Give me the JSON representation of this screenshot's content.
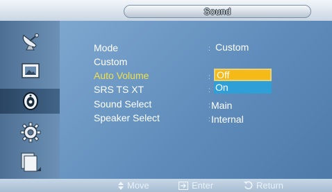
{
  "title": "Sound",
  "sidebar": {
    "items": [
      {
        "icon": "satellite-antenna-icon",
        "active": false
      },
      {
        "icon": "picture-frame-icon",
        "active": false
      },
      {
        "icon": "speaker-icon",
        "active": true
      },
      {
        "icon": "gear-icon",
        "active": false
      },
      {
        "icon": "multi-screen-icon",
        "active": false
      }
    ]
  },
  "menu": {
    "mode_label": "Mode",
    "mode_value": "Custom",
    "custom_label": "Custom",
    "auto_volume_label": "Auto Volume",
    "srs_label": "SRS TS XT",
    "sound_select_label": "Sound Select",
    "sound_select_value": "Main",
    "speaker_select_label": "Speaker Select",
    "speaker_select_value": "Internal",
    "separator": ":"
  },
  "dropdown": {
    "options": [
      "Off",
      "On"
    ],
    "selected": "Off"
  },
  "footer": {
    "move_label": "Move",
    "enter_label": "Enter",
    "return_label": "Return"
  },
  "colors": {
    "highlight_text": "#f0e04a",
    "selected_option": "#f5b918",
    "option_bg": "#2f9fd8"
  }
}
